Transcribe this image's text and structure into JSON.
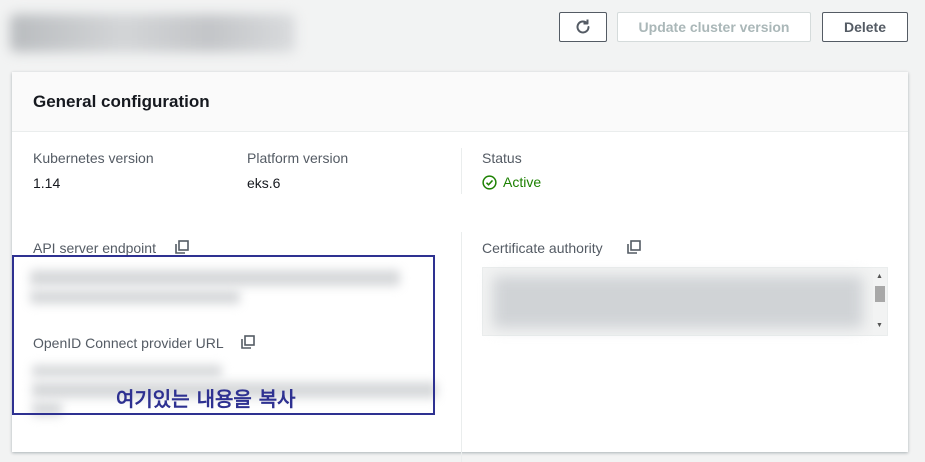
{
  "header": {
    "refresh_icon": "refresh-icon",
    "update_label": "Update cluster version",
    "delete_label": "Delete"
  },
  "panel": {
    "title": "General configuration",
    "kubernetes_version": {
      "label": "Kubernetes version",
      "value": "1.14"
    },
    "platform_version": {
      "label": "Platform version",
      "value": "eks.6"
    },
    "status": {
      "label": "Status",
      "value": "Active",
      "icon": "check-circle-icon",
      "color": "#1d8102"
    },
    "api_endpoint": {
      "label": "API server endpoint",
      "icon": "copy-icon"
    },
    "certificate_authority": {
      "label": "Certificate authority",
      "icon": "copy-icon"
    },
    "oidc": {
      "label": "OpenID Connect provider URL",
      "icon": "copy-icon"
    }
  },
  "annotation": {
    "text": "여기있는 내용을 복사",
    "color": "#2e3191"
  }
}
